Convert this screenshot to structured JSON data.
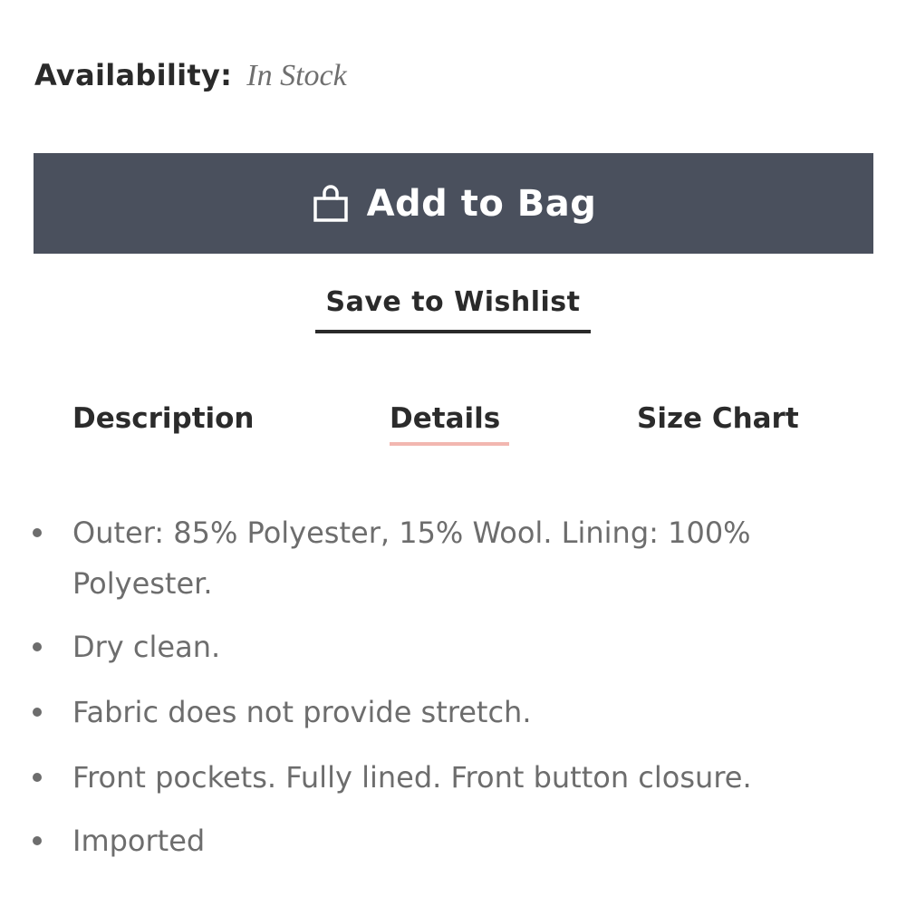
{
  "availability": {
    "label": "Availability:",
    "value": "In Stock"
  },
  "actions": {
    "add_to_bag_label": "Add to Bag",
    "add_to_bag_icon": "shopping-bag-icon",
    "save_to_wishlist_label": "Save to Wishlist"
  },
  "tabs": [
    {
      "label": "Description",
      "active": false
    },
    {
      "label": "Details",
      "active": true
    },
    {
      "label": "Size Chart",
      "active": false
    }
  ],
  "details": [
    "Outer: 85% Polyester, 15% Wool. Lining: 100% Polyester.",
    "Dry clean.",
    "Fabric does not provide stretch.",
    "Front pockets. Fully lined. Front button closure.",
    "Imported"
  ],
  "colors": {
    "primary_button": "#4a505d",
    "active_tab_underline": "#f2b7b0",
    "text_dark": "#2a2a2a",
    "text_muted": "#6d6d6d"
  }
}
